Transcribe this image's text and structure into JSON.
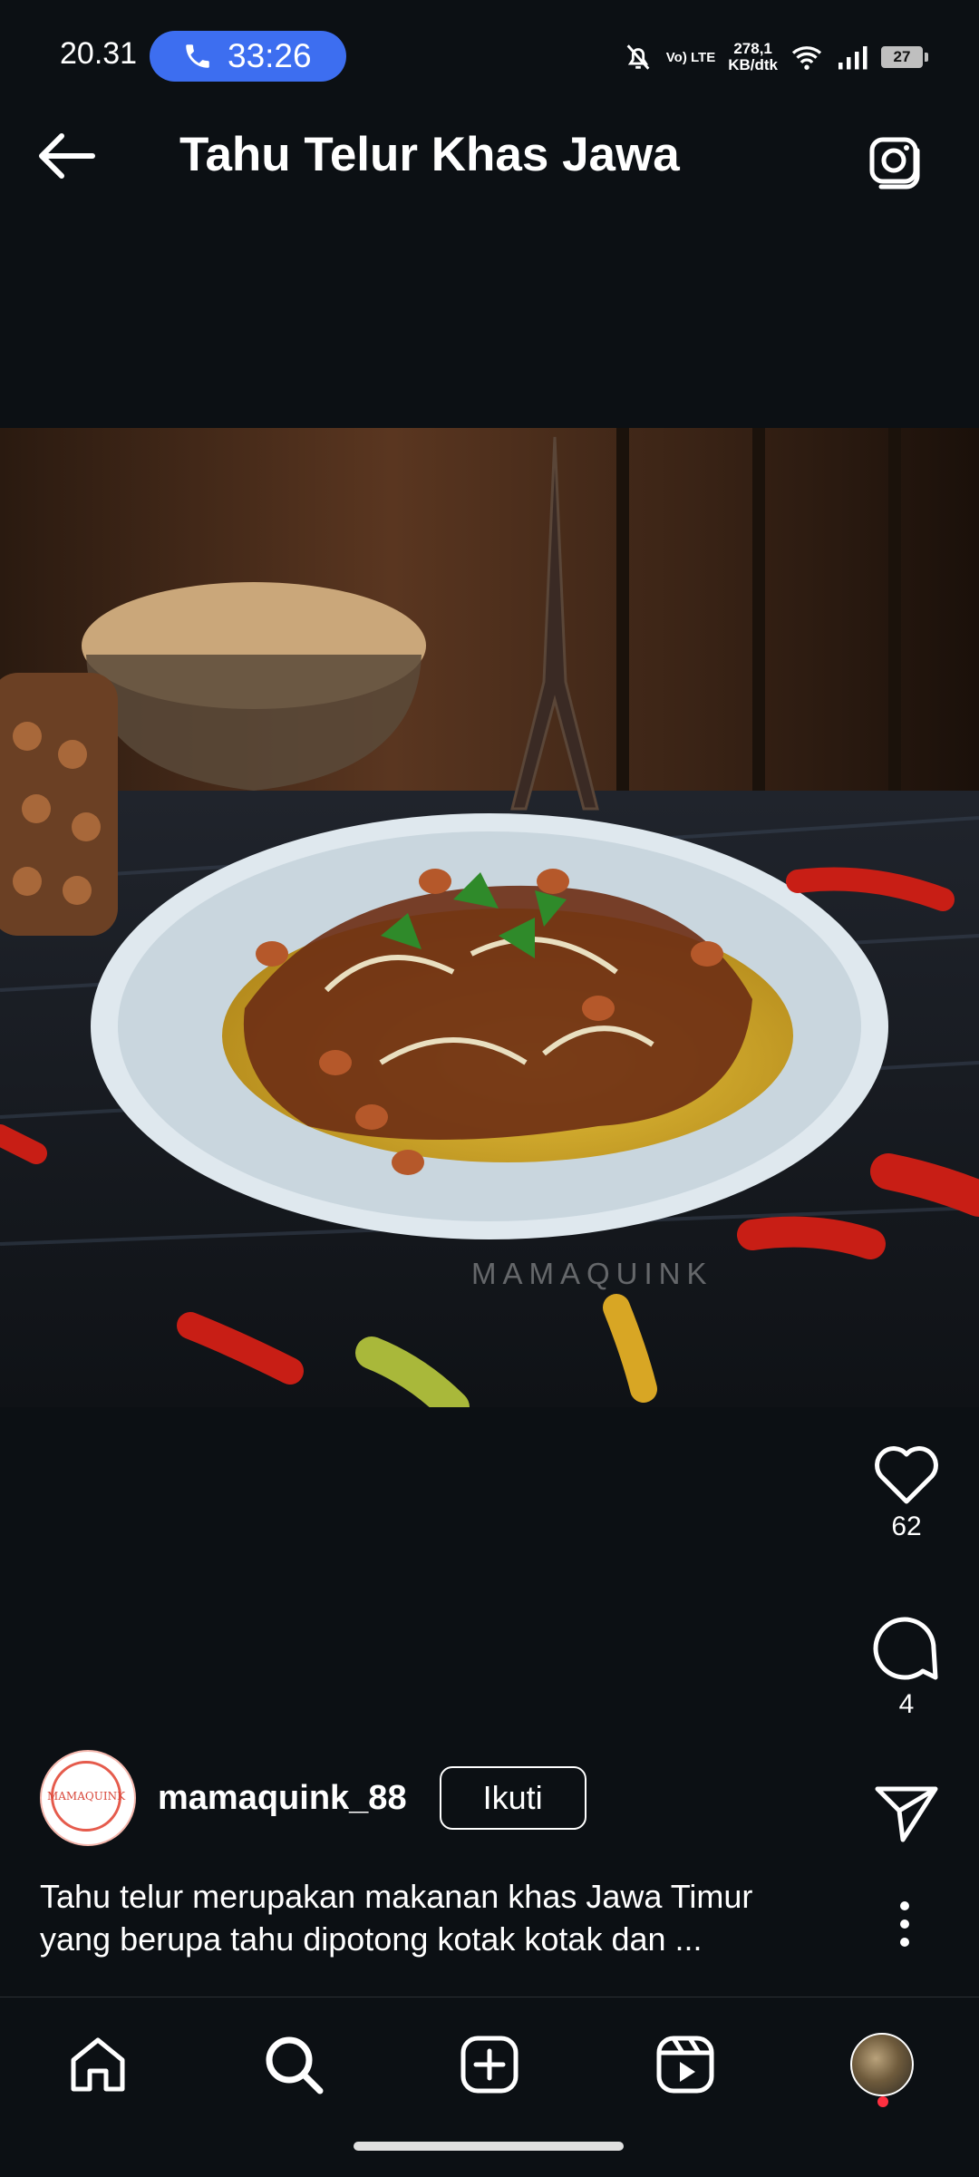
{
  "status_bar": {
    "time": "20.31",
    "call_timer": "33:26",
    "network_speed_value": "278,1",
    "network_speed_unit": "KB/dtk",
    "volte": "Vo) LTE",
    "battery": "27"
  },
  "header": {
    "title": "Tahu Telur Khas Jawa"
  },
  "post": {
    "watermark": "MAMAQUINK",
    "likes": "62",
    "comments": "4",
    "author": {
      "username": "mamaquink_88",
      "avatar_text": "MAMAQUINK"
    },
    "follow_label": "Ikuti",
    "caption_line1": "Tahu telur merupakan makanan khas Jawa Timur",
    "caption_line2": "yang berupa tahu dipotong kotak kotak dan ..."
  },
  "bottom_nav": {
    "items": [
      "home-icon",
      "search-icon",
      "create-icon",
      "reels-icon",
      "profile-avatar"
    ],
    "notification_color": "#ff3040"
  },
  "colors": {
    "background": "#0c1014",
    "call_pill": "#3d6ef0"
  }
}
